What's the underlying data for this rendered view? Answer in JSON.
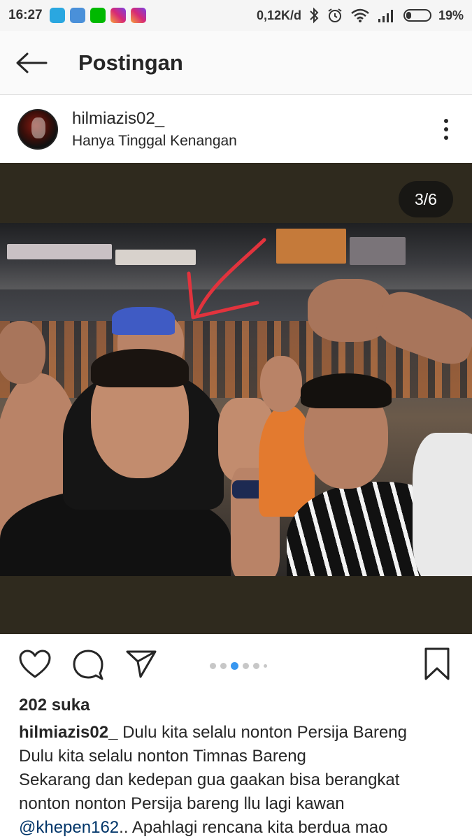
{
  "status_bar": {
    "time": "16:27",
    "network_speed": "0,12K/d",
    "battery_percent": "19%",
    "notification_icons": [
      "app-icon-blue",
      "app-icon-square",
      "line-icon",
      "instagram-icon",
      "instagram-icon"
    ]
  },
  "app_bar": {
    "title": "Postingan",
    "back_icon": "arrow-left-icon"
  },
  "post": {
    "username": "hilmiazis02_",
    "location": "Hanya Tinggal Kenangan",
    "media_counter": "3/6",
    "carousel": {
      "total": 6,
      "current": 3
    },
    "likes": "202 suka",
    "caption_user": "hilmiazis02_",
    "caption_lines": [
      "Dulu kita selalu nonton Persija Bareng",
      "Dulu kita selalu nonton Timnas Bareng",
      "Sekarang dan kedepan gua gaakan bisa berangkat",
      "nonton nonton Persija bareng llu lagi kawan"
    ],
    "caption_mention": "@khepen162",
    "caption_tail": ".. Apahlagi rencana kita berdua mao"
  },
  "colors": {
    "accent_blue": "#3897f0",
    "text": "#262626",
    "mention": "#003569",
    "media_bg": "#2f2a1e"
  }
}
